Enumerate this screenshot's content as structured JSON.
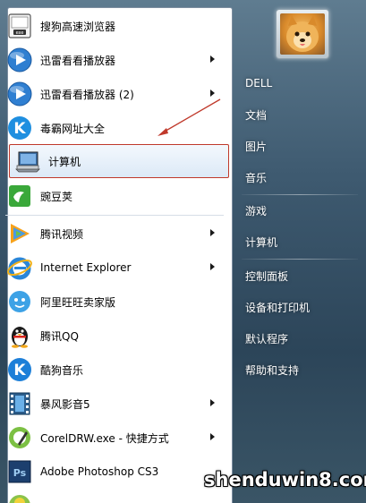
{
  "start_menu": {
    "left_items": [
      {
        "label": "搜狗高速浏览器",
        "icon": "sogou-browser-icon",
        "has_arrow": false
      },
      {
        "label": "迅雷看看播放器",
        "icon": "xunlei-player-icon",
        "has_arrow": true
      },
      {
        "label": "迅雷看看播放器 (2)",
        "icon": "xunlei-player-icon",
        "has_arrow": true
      },
      {
        "label": "毒霸网址大全",
        "icon": "duba-k-icon",
        "has_arrow": false
      },
      {
        "label": "计算机",
        "icon": "computer-icon",
        "has_arrow": false,
        "selected": true
      },
      {
        "label": "豌豆荚",
        "icon": "wandoujia-icon",
        "has_arrow": false
      },
      {
        "label": "腾讯视频",
        "icon": "tencent-video-icon",
        "has_arrow": true
      },
      {
        "label": "Internet Explorer",
        "icon": "internet-explorer-icon",
        "has_arrow": true
      },
      {
        "label": "阿里旺旺卖家版",
        "icon": "aliwangwang-icon",
        "has_arrow": false
      },
      {
        "label": "腾讯QQ",
        "icon": "qq-penguin-icon",
        "has_arrow": false
      },
      {
        "label": "酷狗音乐",
        "icon": "kugou-k-icon",
        "has_arrow": false
      },
      {
        "label": "暴风影音5",
        "icon": "baofeng-film-icon",
        "has_arrow": true
      },
      {
        "label": "CorelDRW.exe - 快捷方式",
        "icon": "coreldraw-icon",
        "has_arrow": true
      },
      {
        "label": "Adobe Photoshop CS3",
        "icon": "photoshop-icon",
        "has_arrow": false
      }
    ],
    "right_items": [
      {
        "label": "DELL"
      },
      {
        "label": "文档"
      },
      {
        "label": "图片"
      },
      {
        "label": "音乐"
      },
      {
        "label": "游戏"
      },
      {
        "label": "计算机"
      },
      {
        "label": "控制面板"
      },
      {
        "label": "设备和打印机"
      },
      {
        "label": "默认程序"
      },
      {
        "label": "帮助和支持"
      }
    ],
    "ps_badge": "Ps"
  },
  "watermark": "shenduwin8.com",
  "colors": {
    "highlight_border": "#c0392b",
    "annotation_arrow": "#c0392b",
    "right_text": "#ffffff"
  }
}
